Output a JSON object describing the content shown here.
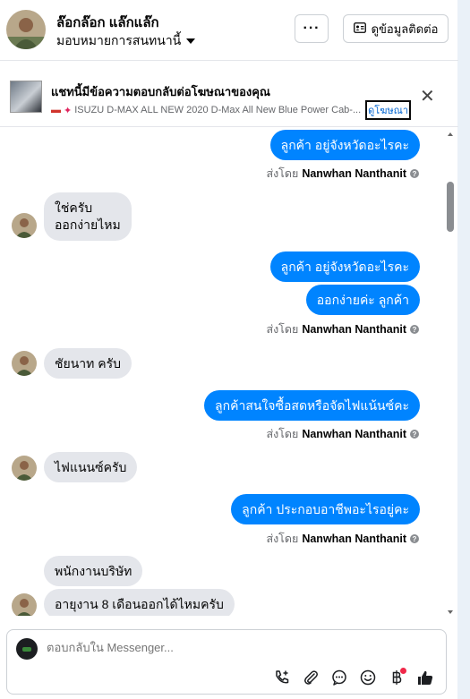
{
  "header": {
    "name": "ล๊อกล๊อก แล๊กแล๊ก",
    "assignment": "มอบหมายการสนทนานี้",
    "more_label": "···",
    "contact_label": "ดูข้อมูลติดต่อ"
  },
  "ad_banner": {
    "title": "แชทนี้มีข้อความตอบกลับต่อโฆษณาของคุณ",
    "description": "ISUZU D-MAX ALL NEW 2020 D-Max All New Blue Power Cab-...",
    "link": "ดูโฆษณา"
  },
  "messages": [
    {
      "side": "out",
      "text": "ลูกค้า อยู่จังหวัดอะไรคะ"
    },
    {
      "side": "meta",
      "prefix": "ส่งโดย",
      "name": "Nanwhan Nanthanit"
    },
    {
      "side": "in",
      "lines": [
        "ใช่ครับ",
        "ออกง่ายไหม"
      ]
    },
    {
      "side": "out",
      "text": "ลูกค้า อยู่จังหวัดอะไรคะ"
    },
    {
      "side": "out",
      "text": "ออกง่ายค่ะ  ลูกค้า"
    },
    {
      "side": "meta",
      "prefix": "ส่งโดย",
      "name": "Nanwhan Nanthanit"
    },
    {
      "side": "in",
      "text": "ชัยนาท ครับ"
    },
    {
      "side": "out",
      "text": "ลูกค้าสนใจซื้อสดหรือจัดไฟแน้นซ์คะ"
    },
    {
      "side": "meta",
      "prefix": "ส่งโดย",
      "name": "Nanwhan Nanthanit"
    },
    {
      "side": "in",
      "text": "ไฟแนนซ์ครับ"
    },
    {
      "side": "out",
      "text": "ลูกค้า ประกอบอาชีพอะไรอยู่คะ"
    },
    {
      "side": "meta",
      "prefix": "ส่งโดย",
      "name": "Nanwhan Nanthanit"
    },
    {
      "side": "in",
      "text": "พนักงานบริษัท"
    },
    {
      "side": "in",
      "text": "อายุงาน 8 เดือนออกได้ไหมครับ"
    }
  ],
  "composer": {
    "placeholder": "ตอบกลับใน Messenger..."
  },
  "colors": {
    "outgoing": "#0084ff",
    "incoming": "#e4e6eb",
    "notification": "#f02849"
  }
}
